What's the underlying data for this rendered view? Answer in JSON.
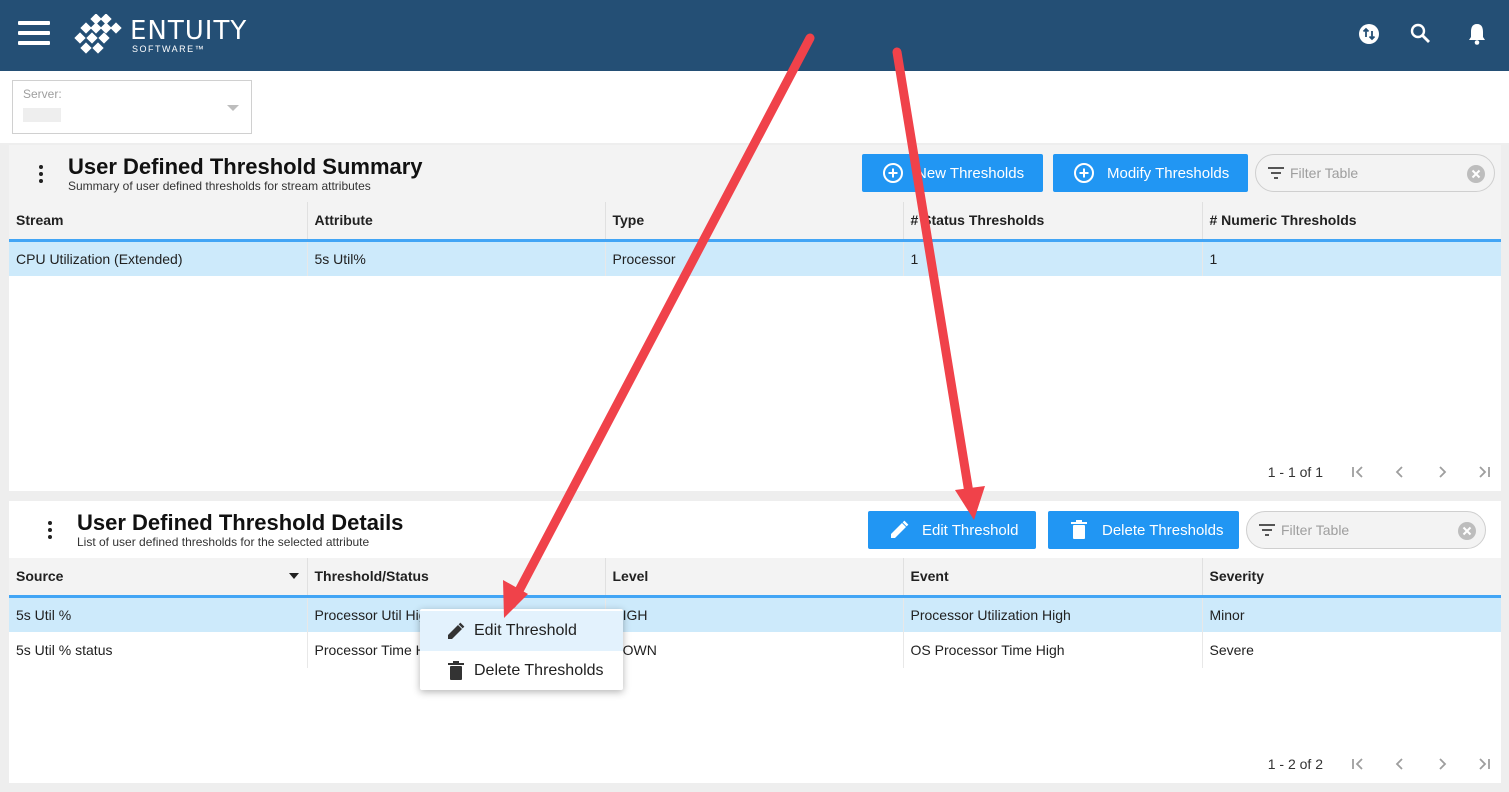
{
  "header": {
    "logo_word": "ENTUITY",
    "logo_sub": "SOFTWARE™",
    "icons": [
      "menu-icon",
      "sync-icon",
      "search-icon",
      "bell-icon"
    ],
    "color": "#244f75"
  },
  "server": {
    "label": "Server:"
  },
  "summary": {
    "title": "User Defined Threshold Summary",
    "subtitle": "Summary of user defined thresholds for stream attributes",
    "buttons": {
      "new": "New Thresholds",
      "modify": "Modify Thresholds"
    },
    "filter_placeholder": "Filter Table",
    "columns": [
      "Stream",
      "Attribute",
      "Type",
      "# Status Thresholds",
      "# Numeric Thresholds"
    ],
    "rows": [
      [
        "CPU Utilization (Extended)",
        "5s Util%",
        "Processor",
        "1",
        "1"
      ]
    ],
    "pager": "1 - 1 of 1"
  },
  "details": {
    "title": "User Defined Threshold Details",
    "subtitle": "List of user defined thresholds for the selected attribute",
    "buttons": {
      "edit": "Edit Threshold",
      "delete": "Delete Thresholds"
    },
    "filter_placeholder": "Filter Table",
    "columns": [
      "Source",
      "Threshold/Status",
      "Level",
      "Event",
      "Severity"
    ],
    "rows": [
      [
        "5s Util %",
        "Processor Util High",
        "HIGH",
        "Processor Utilization High",
        "Minor"
      ],
      [
        "5s Util % status",
        "Processor Time High",
        "DOWN",
        "OS Processor Time High",
        "Severe"
      ]
    ],
    "pager": "1 - 2 of 2"
  },
  "context_menu": {
    "items": [
      "Edit Threshold",
      "Delete Thresholds"
    ]
  },
  "colors": {
    "accent": "#2196f3",
    "selected_row": "#cdeafb",
    "annotation_arrow": "#f0424a"
  }
}
